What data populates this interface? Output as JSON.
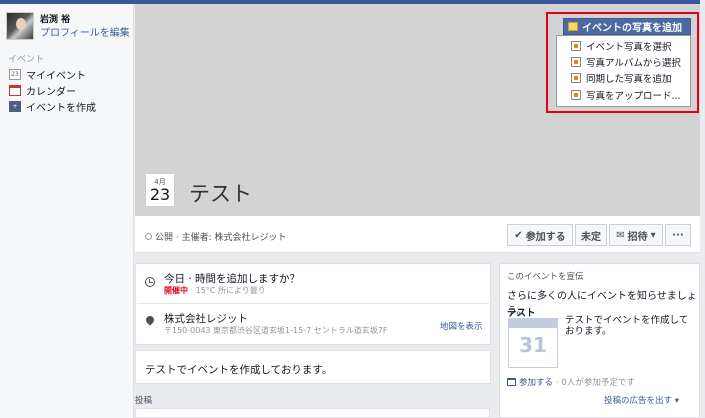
{
  "profile": {
    "name": "岩渕 裕",
    "edit_label": "プロフィールを編集"
  },
  "sidebar": {
    "section_label": "イベント",
    "items": [
      {
        "label": "マイイベント",
        "icon": "calendar-23-icon",
        "glyph": "23"
      },
      {
        "label": "カレンダー",
        "icon": "calendar-icon",
        "glyph": ""
      },
      {
        "label": "イベントを作成",
        "icon": "create-event-icon",
        "glyph": "+"
      }
    ]
  },
  "cover": {
    "add_photo_label": "イベントの写真を追加",
    "menu": [
      {
        "label": "イベント写真を選択",
        "icon": "photo-select-icon"
      },
      {
        "label": "写真アルバムから選択",
        "icon": "album-icon"
      },
      {
        "label": "同期した写真を追加",
        "icon": "sync-photo-icon"
      },
      {
        "label": "写真をアップロード...",
        "icon": "upload-icon"
      }
    ]
  },
  "event": {
    "month": "4月",
    "day": "23",
    "title": "テスト"
  },
  "actionbar": {
    "privacy": "公開 · 主催者: 株式会社レジット",
    "join": "参加する",
    "maybe": "未定",
    "invite": "招待",
    "more": "···"
  },
  "details": {
    "when_title": "今日 · 時間を追加しますか？",
    "when_live": "開催中",
    "when_weather": " · 15°C 所により曇り",
    "loc_name": "株式会社レジット",
    "loc_addr": "〒150-0043 東京都渋谷区道玄坂1-15-7 セントラル道玄坂7F",
    "map_link": "地図を表示",
    "description": "テストでイベントを作成しております。",
    "post_label": "投稿"
  },
  "promo": {
    "heading": "このイベントを宣伝",
    "subtitle": "さらに多くの人にイベントを知らせましょう。",
    "event_name": "テスト",
    "cal_day": "31",
    "text": "テストでイベントを作成しております。",
    "join": "参加する",
    "count": " · 0人が参加予定です",
    "ad_link": "投稿の広告を出す ▾"
  },
  "colors": {
    "brand": "#3b5998",
    "highlight": "#e0001b",
    "live": "#e3001b"
  }
}
